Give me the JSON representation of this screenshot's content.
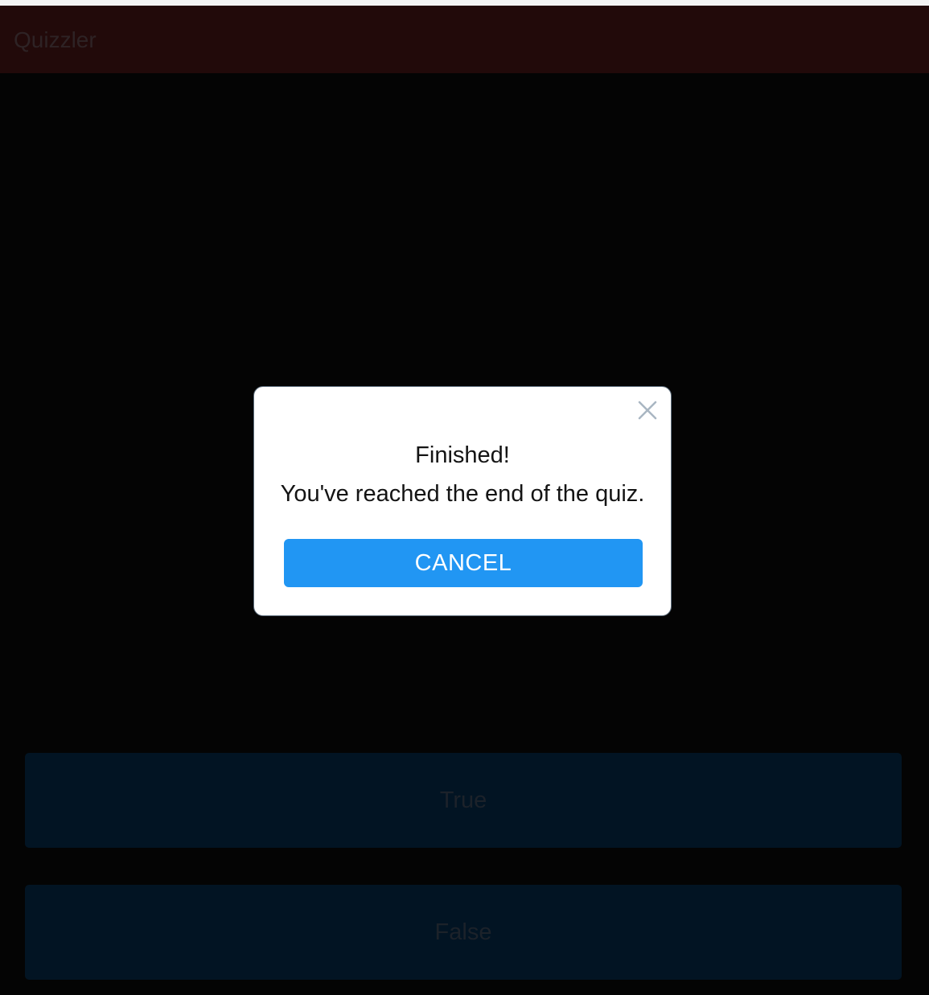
{
  "app_bar": {
    "title": "Quizzler"
  },
  "answers": {
    "true_label": "True",
    "false_label": "False"
  },
  "dialog": {
    "title": "Finished!",
    "message": "You've reached the end of the quiz.",
    "cancel_label": "CANCEL",
    "close_icon": "close-icon"
  },
  "colors": {
    "accent": "#2196f3",
    "app_bar": "#220a0a",
    "answer_button": "#021423",
    "background": "#040404"
  }
}
